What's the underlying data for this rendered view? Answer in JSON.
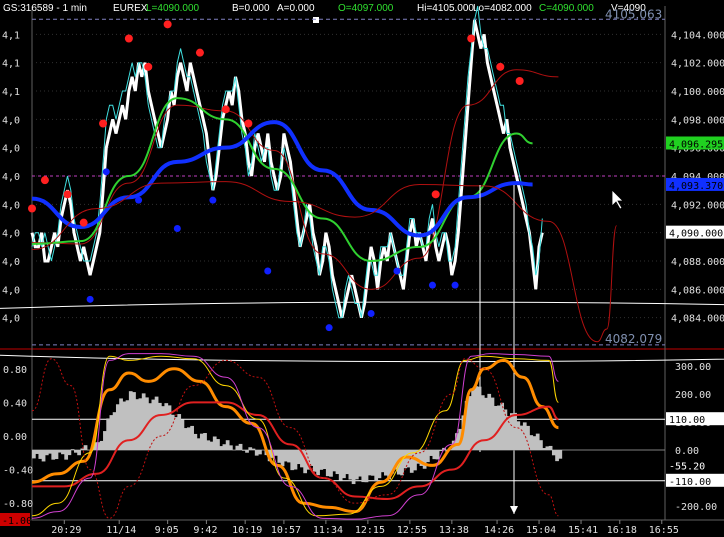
{
  "header": {
    "symbol": "GS:316589 - 1 min",
    "exchange": "EUREX",
    "last": "L=4090.000",
    "bid": "B=0.000",
    "ask": "A=0.000",
    "open": "O=4097.000",
    "high": "Hi=4105.000",
    "low": "Lo=4082.000",
    "close": "C=4090.000",
    "volume": "V=4090"
  },
  "colors": {
    "background": "#000000",
    "price": "#ffffff",
    "thin_price": "#40e0e0",
    "ma_fast": "#b01010",
    "ma_mid": "#30d030",
    "ma_slow": "#1030ff",
    "swing_high": "#ff2020",
    "swing_low": "#1020ff",
    "osc_orange": "#ff8c00",
    "osc_yellow": "#ffd700",
    "osc_magenta": "#d040d0",
    "osc_red": "#e02020",
    "histogram": "#c0c0c0"
  },
  "chart_data": [
    {
      "type": "line",
      "panel": "price",
      "title": "",
      "ylim": [
        4082,
        4106
      ],
      "y_ticks": [
        "4,104.000",
        "4,102.000",
        "4,100.000",
        "4,098.000",
        "4,096.000",
        "4,094.000",
        "4,092.000",
        "4,090.000",
        "4,088.000",
        "4,086.000",
        "4,084.000"
      ],
      "y_tick_values": [
        4104,
        4102,
        4100,
        4098,
        4096,
        4094,
        4092,
        4090,
        4088,
        4086,
        4084
      ],
      "left_labels": [
        "4,1",
        "4,1",
        "4,1",
        "4,0",
        "4,0",
        "4,0",
        "4,0",
        "4,0",
        "4,0",
        "4,0",
        "4,0"
      ],
      "level_labels": [
        {
          "text": "4105.063",
          "value": 4105.063
        },
        {
          "text": "4082.079",
          "value": 4082.079
        }
      ],
      "badges": [
        {
          "text": "4,096.295",
          "value": 4096.295,
          "color": "#20d020",
          "text_color": "#000000"
        },
        {
          "text": "4,093.370",
          "value": 4093.37,
          "color": "#1030ff",
          "text_color": "#000000"
        },
        {
          "text": "4,090.000",
          "value": 4090.0,
          "color": "#ffffff",
          "text_color": "#000000"
        }
      ],
      "series": [
        {
          "role": "close",
          "values": [
            4090,
            4089,
            4089,
            4090,
            4088,
            4088,
            4089,
            4090,
            4089,
            4091,
            4092,
            4093,
            4092,
            4090,
            4089,
            4088,
            4089,
            4088,
            4087,
            4088,
            4089,
            4090,
            4093,
            4096,
            4097,
            4098,
            4097,
            4098,
            4099,
            4098,
            4100,
            4101,
            4100,
            4102,
            4101,
            4102,
            4100,
            4099,
            4098,
            4097,
            4096,
            4097,
            4098,
            4100,
            4099,
            4101,
            4102,
            4101,
            4100,
            4102,
            4101,
            4100,
            4099,
            4098,
            4097,
            4095,
            4093,
            4094,
            4096,
            4098,
            4099,
            4100,
            4099,
            4101,
            4100,
            4098,
            4097,
            4095,
            4094,
            4096,
            4097,
            4096,
            4095,
            4097,
            4095,
            4094,
            4093,
            4094,
            4097,
            4096,
            4095,
            4093,
            4091,
            4089,
            4090,
            4091,
            4092,
            4090,
            4089,
            4087,
            4088,
            4090,
            4089,
            4087,
            4086,
            4085,
            4084,
            4085,
            4086,
            4087,
            4086,
            4085,
            4084,
            4085,
            4087,
            4089,
            4088,
            4086,
            4088,
            4089,
            4088,
            4090,
            4089,
            4088,
            4087,
            4086,
            4088,
            4090,
            4091,
            4089,
            4090,
            4089,
            4088,
            4090,
            4091,
            4089,
            4088,
            4089,
            4090,
            4089,
            4087,
            4088,
            4090,
            4093,
            4096,
            4099,
            4102,
            4105,
            4104,
            4103,
            4104,
            4102,
            4101,
            4100,
            4099,
            4098,
            4097,
            4098,
            4096,
            4095,
            4094,
            4093,
            4092,
            4091,
            4090,
            4088,
            4086,
            4089,
            4090
          ],
          "color": "#ffffff"
        },
        {
          "role": "close-thin",
          "values": [
            4089,
            4090,
            4090,
            4089,
            4090,
            4089,
            4088,
            4089,
            4090,
            4092,
            4093,
            4094,
            4093,
            4091,
            4090,
            4089,
            4088,
            4088,
            4088,
            4089,
            4090,
            4092,
            4095,
            4098,
            4099,
            4099,
            4098,
            4099,
            4100,
            4100,
            4101,
            4102,
            4101,
            4102,
            4102,
            4101,
            4099,
            4098,
            4097,
            4096,
            4096,
            4098,
            4099,
            4100,
            4100,
            4102,
            4103,
            4102,
            4101,
            4101,
            4100,
            4099,
            4098,
            4097,
            4095,
            4094,
            4093,
            4095,
            4097,
            4099,
            4100,
            4100,
            4100,
            4101,
            4099,
            4097,
            4096,
            4094,
            4095,
            4097,
            4096,
            4095,
            4096,
            4096,
            4094,
            4093,
            4093,
            4095,
            4096,
            4095,
            4094,
            4092,
            4090,
            4089,
            4090,
            4092,
            4091,
            4089,
            4088,
            4087,
            4089,
            4089,
            4088,
            4086,
            4085,
            4084,
            4084,
            4086,
            4087,
            4086,
            4085,
            4085,
            4084,
            4086,
            4088,
            4088,
            4087,
            4087,
            4089,
            4089,
            4089,
            4090,
            4089,
            4088,
            4087,
            4087,
            4089,
            4091,
            4091,
            4090,
            4090,
            4089,
            4089,
            4091,
            4092,
            4090,
            4089,
            4090,
            4090,
            4088,
            4088,
            4089,
            4092,
            4095,
            4098,
            4101,
            4103,
            4105,
            4106,
            4104,
            4103,
            4103,
            4102,
            4101,
            4100,
            4099,
            4099,
            4097,
            4097,
            4096,
            4095,
            4094,
            4093,
            4092,
            4090,
            4089,
            4087,
            4088,
            4091
          ],
          "color": "#40e0e0"
        },
        {
          "role": "ma_fast",
          "color": "#b01010",
          "x": [
            0,
            15,
            30,
            45,
            60,
            75,
            90,
            105,
            120,
            135,
            150,
            163
          ],
          "values": [
            4089.3,
            4089.2,
            4093.5,
            4099.0,
            4098.6,
            4095.8,
            4088.5,
            4086.0,
            4088.2,
            4099.0,
            4101.5,
            4101.0
          ]
        },
        {
          "role": "ma_mid",
          "color": "#30d030",
          "x": [
            0,
            15,
            30,
            45,
            60,
            75,
            90,
            105,
            120,
            135,
            150,
            155
          ],
          "values": [
            4089.2,
            4089.4,
            4094.0,
            4099.5,
            4098.0,
            4094.5,
            4091.0,
            4088.0,
            4089.0,
            4092.5,
            4097.0,
            4096.3
          ]
        },
        {
          "role": "ma_slow",
          "color": "#1030ff",
          "x": [
            0,
            15,
            30,
            45,
            60,
            75,
            90,
            105,
            120,
            135,
            150,
            155
          ],
          "values": [
            4092.4,
            4090.4,
            4092.5,
            4095.0,
            4096.0,
            4097.8,
            4094.4,
            4091.6,
            4089.8,
            4092.5,
            4093.5,
            4093.4
          ]
        },
        {
          "role": "cycle_arc",
          "color": "#b01010",
          "x": [
            0,
            20,
            40,
            60,
            80,
            100,
            120,
            140,
            160,
            175,
            178,
            181
          ],
          "values": [
            4088.8,
            4091.7,
            4093.5,
            4093.6,
            4092.2,
            4091.1,
            4093.4,
            4093.3,
            4090.8,
            4082.3,
            4083.2,
            4090.5
          ]
        }
      ],
      "swing_highs": [
        {
          "x": 0,
          "y": 4091
        },
        {
          "x": 4,
          "y": 4093
        },
        {
          "x": 11,
          "y": 4092
        },
        {
          "x": 16,
          "y": 4090
        },
        {
          "x": 22,
          "y": 4097
        },
        {
          "x": 30,
          "y": 4103
        },
        {
          "x": 36,
          "y": 4101
        },
        {
          "x": 42,
          "y": 4104
        },
        {
          "x": 52,
          "y": 4102
        },
        {
          "x": 60,
          "y": 4098
        },
        {
          "x": 67,
          "y": 4097
        },
        {
          "x": 125,
          "y": 4092
        },
        {
          "x": 136,
          "y": 4103
        },
        {
          "x": 145,
          "y": 4101
        },
        {
          "x": 151,
          "y": 4100
        }
      ],
      "swing_lows": [
        {
          "x": 18,
          "y": 4086
        },
        {
          "x": 23,
          "y": 4095
        },
        {
          "x": 33,
          "y": 4093
        },
        {
          "x": 45,
          "y": 4091
        },
        {
          "x": 56,
          "y": 4093
        },
        {
          "x": 73,
          "y": 4088
        },
        {
          "x": 92,
          "y": 4084
        },
        {
          "x": 105,
          "y": 4085
        },
        {
          "x": 113,
          "y": 4088
        },
        {
          "x": 124,
          "y": 4087
        },
        {
          "x": 131,
          "y": 4087
        }
      ],
      "ellipse": {
        "x_center": 125,
        "y_center": 4083,
        "x_radius": 52,
        "y_radius": 2.1,
        "color": "#ffffff"
      }
    },
    {
      "type": "line",
      "panel": "oscillator",
      "title": "",
      "ylim_left": [
        -1.0,
        1.0
      ],
      "ylim_right": [
        -250,
        350
      ],
      "left_ticks": [
        "0.80",
        "0.40",
        "0.00",
        "-0.40",
        "-0.80"
      ],
      "left_tick_values": [
        0.8,
        0.4,
        0.0,
        -0.4,
        -0.8
      ],
      "right_ticks": [
        "300.00",
        "200.00",
        "100.00",
        "0.00",
        "-100.00",
        "-200.00"
      ],
      "right_tick_values": [
        300,
        200,
        100,
        0,
        -100,
        -200
      ],
      "badges": [
        {
          "text": "110.00",
          "value": 110,
          "color": "#ffffff",
          "text_color": "#000000"
        },
        {
          "text": "-55.20",
          "value": -55.2,
          "color": "#000000",
          "text_color": "#ffffff"
        },
        {
          "text": "-110.00",
          "value": -110,
          "color": "#ffffff",
          "text_color": "#000000"
        },
        {
          "text": "-1.00",
          "value": -1.0,
          "color": "#cc0000",
          "text_color": "#000000",
          "side": "left"
        }
      ],
      "reference_lines": [
        110,
        -110
      ],
      "series": [
        {
          "role": "histogram",
          "color": "#c0c0c0",
          "x": [
            0,
            10,
            20,
            25,
            30,
            40,
            50,
            60,
            70,
            80,
            90,
            100,
            110,
            120,
            130,
            136,
            142,
            150,
            160,
            163
          ],
          "values": [
            -30,
            -20,
            20,
            150,
            200,
            170,
            60,
            20,
            -10,
            -60,
            -80,
            -110,
            -90,
            -60,
            20,
            230,
            180,
            110,
            0,
            -40
          ]
        },
        {
          "role": "fast_osc",
          "color": "#ff8c00",
          "x": [
            0,
            8,
            16,
            24,
            30,
            36,
            44,
            52,
            60,
            68,
            76,
            84,
            92,
            100,
            108,
            116,
            124,
            132,
            136,
            140,
            146,
            152,
            158,
            163
          ],
          "values": [
            -0.55,
            -0.45,
            -0.3,
            0.55,
            0.75,
            0.65,
            0.8,
            0.65,
            0.35,
            0.15,
            -0.35,
            -0.8,
            -0.85,
            -0.9,
            -0.55,
            -0.25,
            -0.35,
            -0.1,
            0.55,
            0.8,
            0.9,
            0.7,
            0.35,
            0.1
          ]
        },
        {
          "role": "trend_osc",
          "color": "#e02020",
          "x": [
            0,
            10,
            20,
            30,
            40,
            50,
            60,
            70,
            80,
            90,
            100,
            110,
            120,
            130,
            140,
            150,
            160,
            163
          ],
          "values": [
            -0.6,
            -0.6,
            -0.45,
            -0.05,
            0.25,
            0.4,
            0.4,
            0.25,
            -0.1,
            -0.5,
            -0.72,
            -0.75,
            -0.6,
            -0.4,
            -0.05,
            0.25,
            0.35,
            0.2
          ]
        },
        {
          "role": "stoch_k",
          "color": "#ffd700",
          "x": [
            0,
            8,
            18,
            24,
            30,
            40,
            50,
            60,
            70,
            78,
            88,
            98,
            108,
            118,
            128,
            134,
            140,
            150,
            160,
            163
          ],
          "values": [
            -0.95,
            -0.8,
            -0.2,
            0.95,
            0.9,
            0.95,
            0.92,
            0.6,
            0.2,
            -0.5,
            -0.95,
            -0.93,
            -0.6,
            -0.2,
            0.3,
            0.9,
            0.95,
            0.92,
            0.9,
            0.4
          ]
        },
        {
          "role": "stoch_d",
          "color": "#d040d0",
          "x": [
            0,
            8,
            18,
            24,
            30,
            40,
            50,
            60,
            70,
            80,
            90,
            100,
            110,
            120,
            130,
            136,
            142,
            150,
            160,
            163
          ],
          "values": [
            -0.98,
            -0.9,
            -0.5,
            0.9,
            0.98,
            0.98,
            0.95,
            0.7,
            0.1,
            -0.6,
            -0.98,
            -0.99,
            -0.95,
            -0.7,
            -0.1,
            0.95,
            0.98,
            0.97,
            0.95,
            0.65
          ]
        },
        {
          "role": "cycle_dotted",
          "color": "#c01010",
          "x": [
            0,
            6,
            12,
            18,
            24,
            30,
            40,
            50,
            60,
            70,
            80,
            90,
            100,
            110,
            120,
            130,
            134,
            140,
            150,
            160,
            163
          ],
          "values": [
            0.3,
            0.92,
            0.6,
            -0.4,
            -0.98,
            -0.6,
            0.0,
            0.6,
            0.9,
            0.7,
            0.1,
            -0.5,
            -0.8,
            -0.7,
            -0.2,
            0.5,
            0.92,
            0.8,
            0.1,
            -0.7,
            -0.95
          ]
        }
      ]
    }
  ],
  "x_axis": {
    "labels": [
      "20:29",
      "11/14",
      "9:05",
      "9:42",
      "10:19",
      "10:57",
      "11:34",
      "12:15",
      "12:55",
      "13:38",
      "14:26",
      "15:04",
      "15:41",
      "16:18",
      "16:55"
    ],
    "label_positions": [
      10,
      27,
      42,
      54,
      66,
      78,
      91,
      104,
      117,
      130,
      144,
      157,
      170,
      182,
      195
    ]
  },
  "cursor": "arrow-cursor"
}
